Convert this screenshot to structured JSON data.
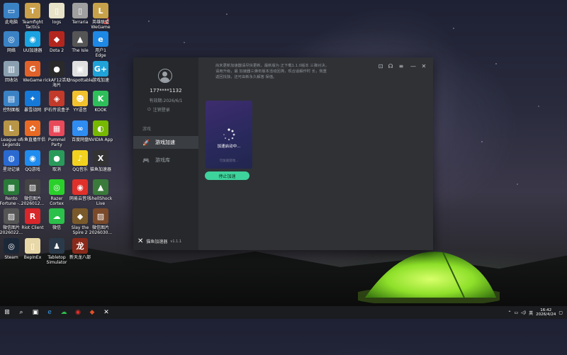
{
  "desktop": {
    "icons": [
      {
        "label": "此电脑",
        "color": "#3b82c4",
        "glyph": "▭"
      },
      {
        "label": "Teamfight\nTactics",
        "color": "#caa04a",
        "glyph": "T"
      },
      {
        "label": "logs",
        "color": "#e8e3c8",
        "glyph": "▯"
      },
      {
        "label": "Terraria",
        "color": "#a0a0a0",
        "glyph": "▯"
      },
      {
        "label": "英雄联盟\nWeGame",
        "color": "#c8a24a",
        "glyph": "L"
      },
      {
        "label": "网络",
        "color": "#3b82c4",
        "glyph": "◎"
      },
      {
        "label": "UU加速器",
        "color": "#1aa3e0",
        "glyph": "◉"
      },
      {
        "label": "Dota 2",
        "color": "#b3261e",
        "glyph": "◆"
      },
      {
        "label": "The Isle",
        "color": "#555555",
        "glyph": "▲"
      },
      {
        "label": "用户1\nEdge",
        "color": "#1e88e5",
        "glyph": "e"
      },
      {
        "label": "回收站",
        "color": "#8aa0b0",
        "glyph": "▥"
      },
      {
        "label": "WeGame",
        "color": "#e0622a",
        "glyph": "G"
      },
      {
        "label": "rickAF12活动\n海片",
        "color": "#2a2a2a",
        "glyph": "●"
      },
      {
        "label": "Unspottable",
        "color": "#e0e0e0",
        "glyph": "▣"
      },
      {
        "label": "游戏加速",
        "color": "#1fa3d8",
        "glyph": "G+"
      },
      {
        "label": "控制面板",
        "color": "#3b82c4",
        "glyph": "▤"
      },
      {
        "label": "暴雪战网",
        "color": "#1479d8",
        "glyph": "✦"
      },
      {
        "label": "炉石传说盒子",
        "color": "#c23a2a",
        "glyph": "◈"
      },
      {
        "label": "YY语音",
        "color": "#f2c12e",
        "glyph": "☻"
      },
      {
        "label": "KOOK",
        "color": "#2fbf5a",
        "glyph": "K"
      },
      {
        "label": "League of\nLegends",
        "color": "#b89648",
        "glyph": "L"
      },
      {
        "label": "斗鱼直播伴侣",
        "color": "#e86a24",
        "glyph": "✿"
      },
      {
        "label": "Pummel\nParty",
        "color": "#e84a5a",
        "glyph": "▦"
      },
      {
        "label": "百度网盘",
        "color": "#2f8cf0",
        "glyph": "∞"
      },
      {
        "label": "NVIDIA App",
        "color": "#76b900",
        "glyph": "◐"
      },
      {
        "label": "星动记录",
        "color": "#2a6ad0",
        "glyph": "◍"
      },
      {
        "label": "QQ游戏",
        "color": "#1f8cf0",
        "glyph": "◉"
      },
      {
        "label": "取消",
        "color": "#2a9a5a",
        "glyph": "●"
      },
      {
        "label": "QQ音乐",
        "color": "#f2d21e",
        "glyph": "♪"
      },
      {
        "label": "猫鱼加速器",
        "color": "#333333",
        "glyph": "X"
      },
      {
        "label": "Rento\nFortune -...",
        "color": "#2a7a3a",
        "glyph": "▩"
      },
      {
        "label": "微信图片\n2026012...",
        "color": "#444444",
        "glyph": "▨"
      },
      {
        "label": "Razer\nCortex",
        "color": "#2ad02a",
        "glyph": "◎"
      },
      {
        "label": "网易云音乐",
        "color": "#e0302a",
        "glyph": "◉"
      },
      {
        "label": "ShellShock\nLive",
        "color": "#3a7a3a",
        "glyph": "▲"
      },
      {
        "label": "微信图片\n2026022...",
        "color": "#555555",
        "glyph": "▨"
      },
      {
        "label": "Riot Client",
        "color": "#d8262a",
        "glyph": "R"
      },
      {
        "label": "微信",
        "color": "#2ac04a",
        "glyph": "☁"
      },
      {
        "label": "Slay the\nSpire 2",
        "color": "#7a5a2a",
        "glyph": "◆"
      },
      {
        "label": "微信图片\n2026030...",
        "color": "#7a4a2a",
        "glyph": "▨"
      },
      {
        "label": "Steam",
        "color": "#1b2838",
        "glyph": "◎"
      },
      {
        "label": "BepInEx",
        "color": "#e8d8a8",
        "glyph": "▯"
      },
      {
        "label": "Tabletop\nSimulator",
        "color": "#2a3a4a",
        "glyph": "♟"
      },
      {
        "label": "新天龙八部",
        "color": "#8a2a1a",
        "glyph": "龙"
      }
    ]
  },
  "app": {
    "user": {
      "phone": "177****1132",
      "expire": "有效期:2026/6/1",
      "logout": "注销登录"
    },
    "section_label": "游戏",
    "nav": [
      {
        "label": "游戏加速",
        "icon": "rocket-icon"
      },
      {
        "label": "游戏库",
        "icon": "gamepad-icon"
      }
    ],
    "notice": "尚未更新加速器请尽快更新。最新版为 正下载1.1.0版本 三弹对决，请用升级，最 加速器三弹年版本活动回溯，现合适解作时 长，我重返回找独，还可由新永久解答 保值。",
    "card": {
      "status": "加速启动中...",
      "faint": "可加速游戏..."
    },
    "stop_button": "停止加速",
    "brand": {
      "name": "猫鱼加速器",
      "version": "v1.1.1"
    },
    "colors": {
      "accent": "#3ed39c",
      "sidebar": "#26282b",
      "panel": "#2f3135"
    }
  },
  "taskbar": {
    "items": [
      "windows-logo-icon",
      "search-icon",
      "task-view-icon",
      "edge-icon",
      "wechat-icon",
      "netease-music-icon",
      "taskbar-app-icon",
      "maoyu-icon"
    ],
    "ime": "英",
    "time": "16:42",
    "date": "2026/4/24"
  }
}
